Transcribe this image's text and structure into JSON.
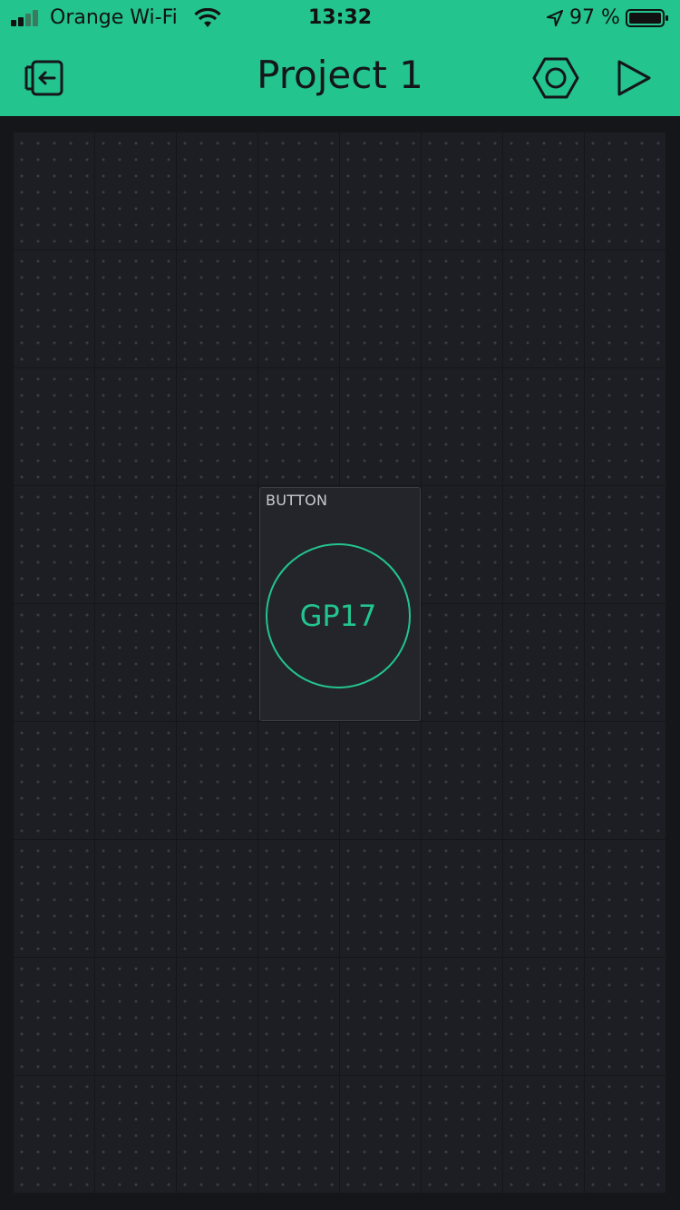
{
  "status_bar": {
    "carrier": "Orange Wi-Fi",
    "time": "13:32",
    "battery": "97 %",
    "icons": [
      "signal-icon",
      "wifi-icon",
      "location-icon",
      "battery-icon"
    ]
  },
  "header": {
    "title": "Project 1",
    "icons": [
      "exit-icon",
      "settings-hexagon-icon",
      "play-icon"
    ]
  },
  "widget": {
    "label": "BUTTON",
    "pin": "GP17"
  },
  "colors": {
    "accent": "#23c48e",
    "background": "#15161a",
    "cell": "#1d1e23",
    "widget_bg": "#23252a"
  }
}
